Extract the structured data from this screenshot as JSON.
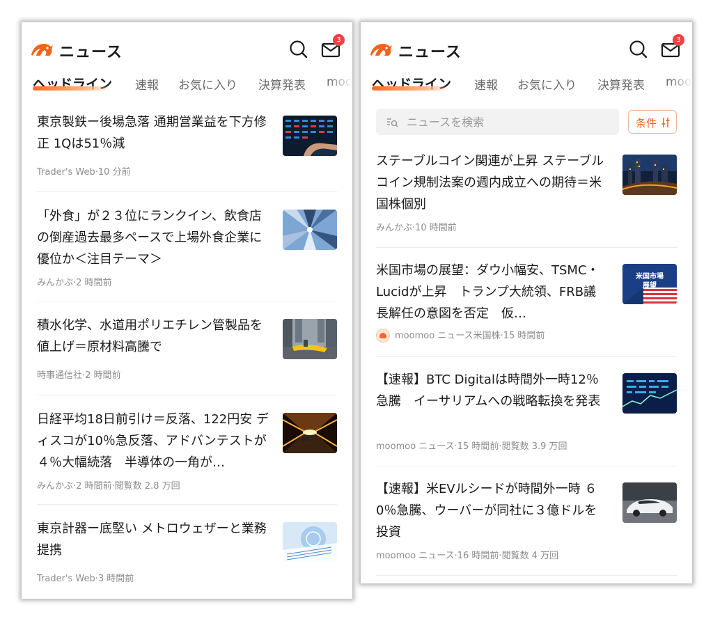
{
  "app": {
    "title": "ニュース",
    "unread_count": "3",
    "tabs": [
      "ヘッドライン",
      "速報",
      "お気に入り",
      "決算発表",
      "moo"
    ],
    "colors": {
      "accent": "#f0651e",
      "badge": "#e94343"
    }
  },
  "search": {
    "placeholder": "ニュースを検索",
    "filter_label": "条件"
  },
  "left_feed": [
    {
      "title": "東京製鉄ー後場急落 通期営業益を下方修正 1Qは51％減",
      "meta": "Trader's Web·10 分前",
      "thumb": "stock-board"
    },
    {
      "title": "「外食」が２３位にランクイン、飲食店の倒産過去最多ペースで上場外食企業に優位か＜注目テーマ＞",
      "meta": "みんかぶ·2 時間前",
      "thumb": "building-up"
    },
    {
      "title": "積水化学、水道用ポリエチレン管製品を値上げ＝原材料高騰で",
      "meta": "時事通信社·2 時間前",
      "thumb": "city-taxi"
    },
    {
      "title": "日経平均18日前引け＝反落、122円安 ディスコが10％急反落、アドバンテストが４％大幅続落　半導体の一角が…",
      "meta": "みんかぶ·2 時間前·閲覧数 2.8 万回",
      "thumb": "tunnel-car"
    },
    {
      "title": "東京計器ー底堅い メトロウェザーと業務提携",
      "meta": "Trader's Web·3 時間前",
      "thumb": "tech-blue"
    }
  ],
  "right_feed": [
    {
      "title": "ステーブルコイン関連が上昇 ステーブルコイン規制法案の週内成立への期待＝米国株個別",
      "meta": "みんかぶ·10 時間前",
      "thumb": "night-city"
    },
    {
      "title": "米国市場の展望：ダウ小幅安、TSMC・Lucidが上昇　トランプ大統領、FRB議長解任の意図を否定　仮…",
      "meta": "moomoo ニュース米国株·15 時間前",
      "thumb": "us-flag",
      "thumb_caption": "米国市場\n展望",
      "has_avatar": true
    },
    {
      "title": "【速報】BTC Digitalは時間外一時12％急騰　イーサリアムへの戦略転換を発表",
      "meta": "moomoo ニュース·15 時間前·閲覧数 3.9 万回",
      "thumb": "data-blue"
    },
    {
      "title": "【速報】米EVルシードが時間外一時 ６0％急騰、ウーバーが同社に３億ドルを投資",
      "meta": "moomoo ニュース·16 時間前·閲覧数 4 万回",
      "thumb": "white-car"
    }
  ]
}
